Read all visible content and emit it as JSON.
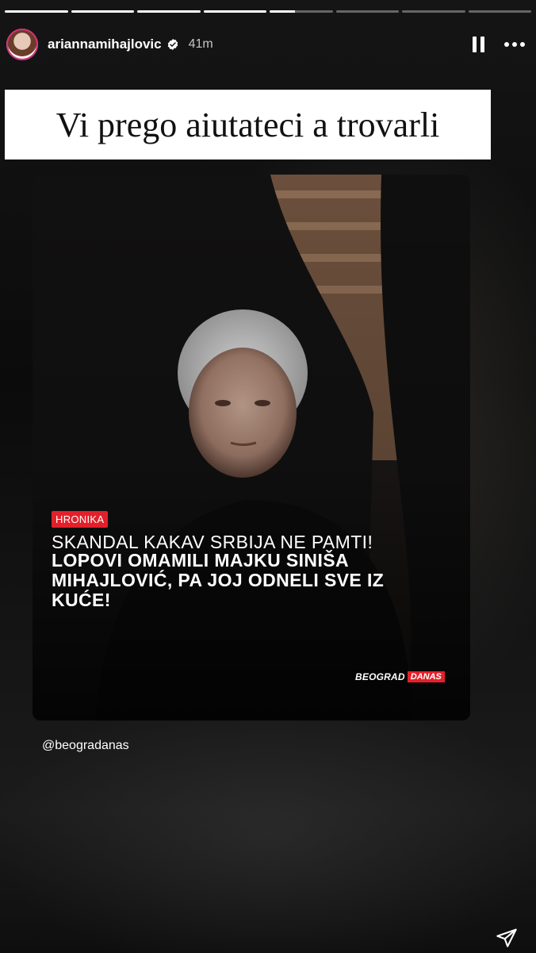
{
  "story": {
    "segments": [
      1,
      1,
      1,
      1,
      0.4,
      0,
      0,
      0
    ],
    "username": "ariannamihajlovic",
    "time": "41m",
    "caption": "Vi prego aiutateci a trovarli"
  },
  "post": {
    "category": "HRONIKA",
    "headline_top": "SKANDAL KAKAV SRBIJA NE PAMTI!",
    "headline_main": "LOPOVI OMAMILI MAJKU SINIŠA MIHAJLOVIĆ, PA JOJ ODNELI SVE IZ KUĆE!",
    "logo_part1": "BEOGRAD",
    "logo_part2": "DANAS"
  },
  "mention": "@beogradanas",
  "icons": {
    "verified": "verified-badge-icon",
    "pause": "pause-icon",
    "more": "more-options-icon",
    "share": "share-send-icon"
  },
  "colors": {
    "accent_red": "#e3202a",
    "verified_blue": "#ffffff"
  }
}
